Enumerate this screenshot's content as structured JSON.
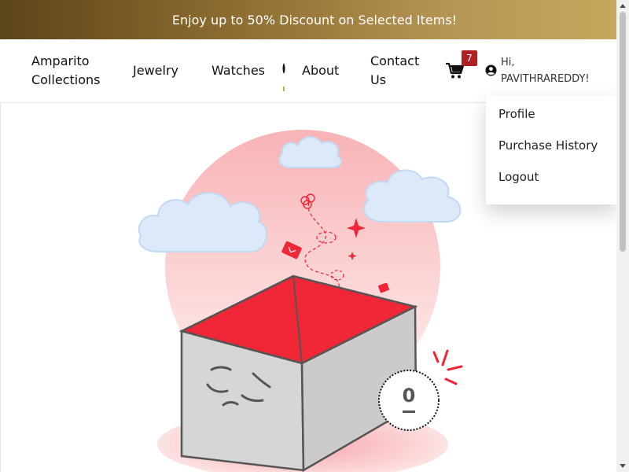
{
  "promo_bar": {
    "text": "Enjoy up to 50% Discount on Selected Items!"
  },
  "nav": {
    "brand": "Amparito Collections",
    "links": [
      "Jewelry",
      "Watches",
      "About",
      "Contact Us"
    ],
    "cart_count": "7",
    "greeting": "Hi, PAVITHRAREDDY!"
  },
  "user_menu": {
    "items": [
      "Profile",
      "Purchase History",
      "Logout"
    ]
  },
  "empty_state": {
    "badge_value": "0"
  },
  "colors": {
    "accent_red": "#ee2636",
    "brand_gold": "#c9a95e",
    "brand_brown": "#5c4519",
    "badge_red": "#b01f24"
  },
  "icons": [
    "cart-icon",
    "user-circle-icon"
  ]
}
